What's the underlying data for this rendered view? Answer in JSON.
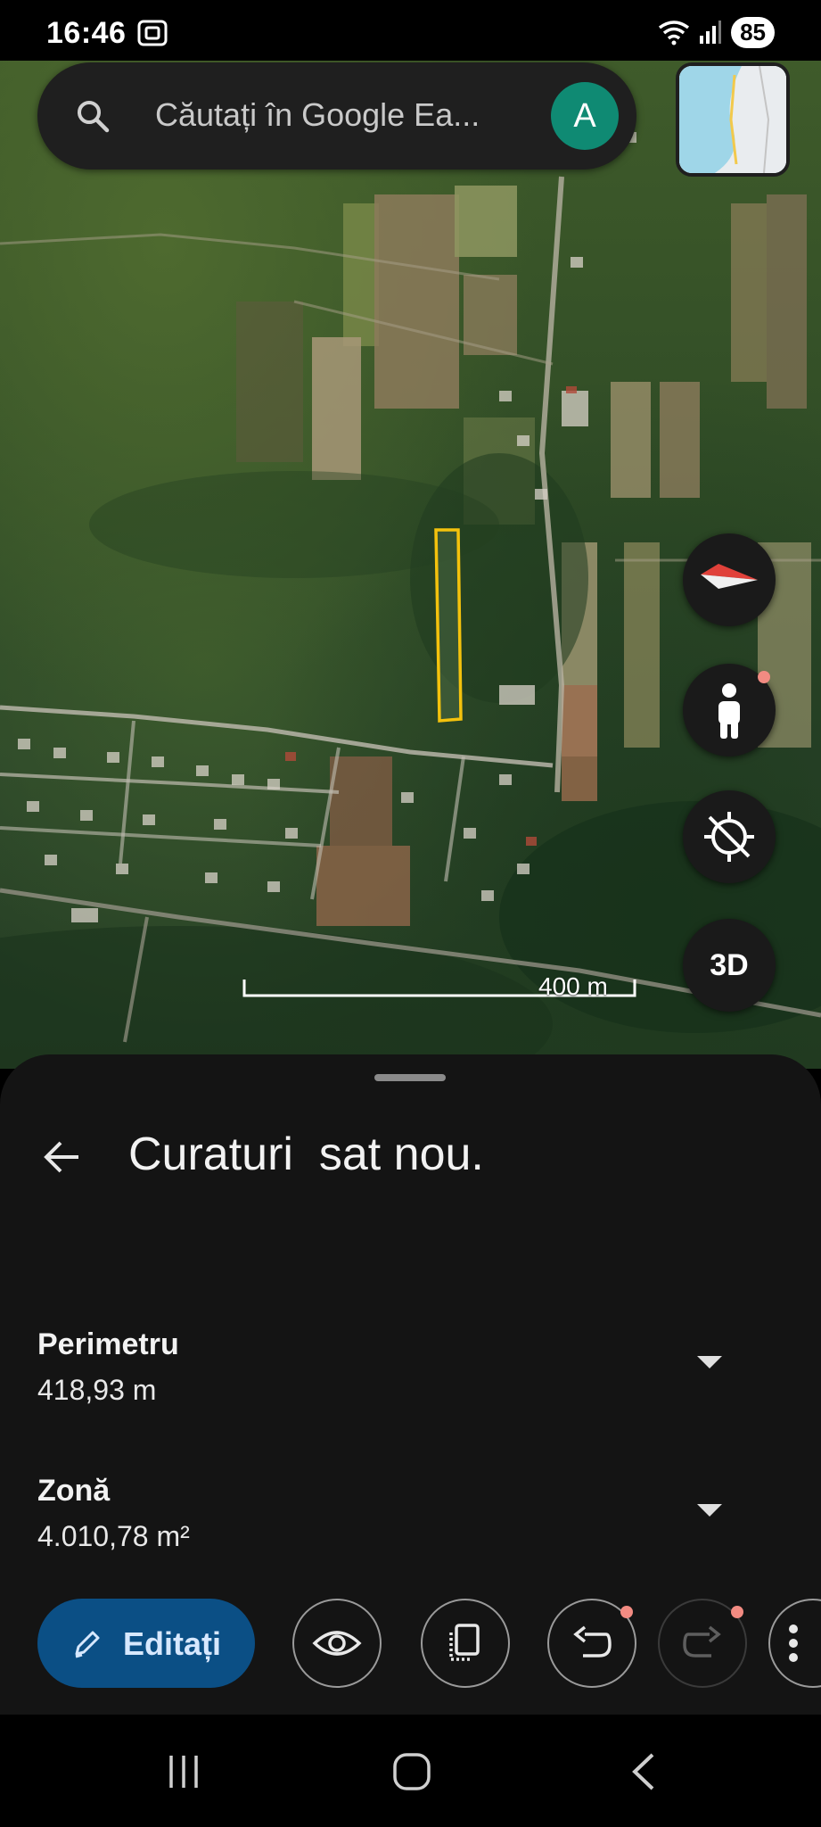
{
  "status_bar": {
    "time": "16:46",
    "battery": "85"
  },
  "search": {
    "placeholder": "Căutați în Google Ea...",
    "avatar_initial": "A"
  },
  "map": {
    "scale_label": "400 m",
    "view_mode_label": "3D"
  },
  "sheet": {
    "title": "Curaturi  sat nou.",
    "measurements": [
      {
        "label": "Perimetru",
        "value": "418,93 m"
      },
      {
        "label": "Zonă",
        "value": "4.010,78 m²"
      }
    ]
  },
  "toolbar": {
    "edit_label": "Editați"
  },
  "colors": {
    "accent_blue": "#0b4f85",
    "polygon_outline": "#f4c20d",
    "avatar_bg": "#0f8a73",
    "notification_dot": "#f28b82",
    "sheet_bg": "#141414"
  },
  "icons": [
    "search-icon",
    "compass-icon",
    "street-view-person-icon",
    "location-off-icon",
    "pencil-icon",
    "eye-icon",
    "layers-icon",
    "undo-icon",
    "redo-icon",
    "more-vert-icon",
    "back-arrow-icon",
    "dropdown-arrow-icon"
  ]
}
